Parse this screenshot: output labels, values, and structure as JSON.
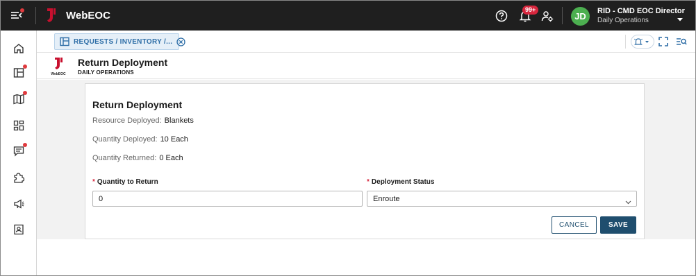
{
  "app": {
    "title": "WebEOC"
  },
  "header": {
    "notifications_badge": "99+",
    "user": {
      "initials": "JD",
      "name": "RID - CMD EOC Director",
      "position": "Daily Operations"
    },
    "icons": [
      "menu-collapse-icon",
      "help-icon",
      "bell-icon",
      "user-settings-icon",
      "chevron-down-icon"
    ]
  },
  "sidebar": {
    "items": [
      {
        "name": "home-icon",
        "alert": false
      },
      {
        "name": "boards-icon",
        "alert": true
      },
      {
        "name": "map-icon",
        "alert": true
      },
      {
        "name": "dashboard-icon",
        "alert": false
      },
      {
        "name": "chat-icon",
        "alert": true
      },
      {
        "name": "plugins-icon",
        "alert": false
      },
      {
        "name": "megaphone-icon",
        "alert": false
      },
      {
        "name": "contact-badge-icon",
        "alert": false
      }
    ]
  },
  "tabs": [
    {
      "label": "REQUESTS / INVENTORY /...",
      "active": true
    }
  ],
  "page": {
    "title": "Return Deployment",
    "subtitle": "DAILY OPERATIONS",
    "logo_text": "WebEOC"
  },
  "form": {
    "title": "Return Deployment",
    "resource_deployed_label": "Resource Deployed:",
    "resource_deployed_value": "Blankets",
    "quantity_deployed_label": "Quantity Deployed:",
    "quantity_deployed_value": "10 Each",
    "quantity_returned_label": "Quantity Returned:",
    "quantity_returned_value": "0 Each",
    "quantity_to_return_label": "Quantity to Return",
    "quantity_to_return_value": "0",
    "deployment_status_label": "Deployment Status",
    "deployment_status_value": "Enroute",
    "required_marker": "*",
    "cancel_label": "CANCEL",
    "save_label": "SAVE"
  },
  "colors": {
    "topbar": "#1f1f1f",
    "accent": "#1f4e6e",
    "tab_text": "#2d6da6",
    "badge": "#d7263d",
    "avatar": "#4caf50",
    "logo_red": "#c8102e"
  }
}
